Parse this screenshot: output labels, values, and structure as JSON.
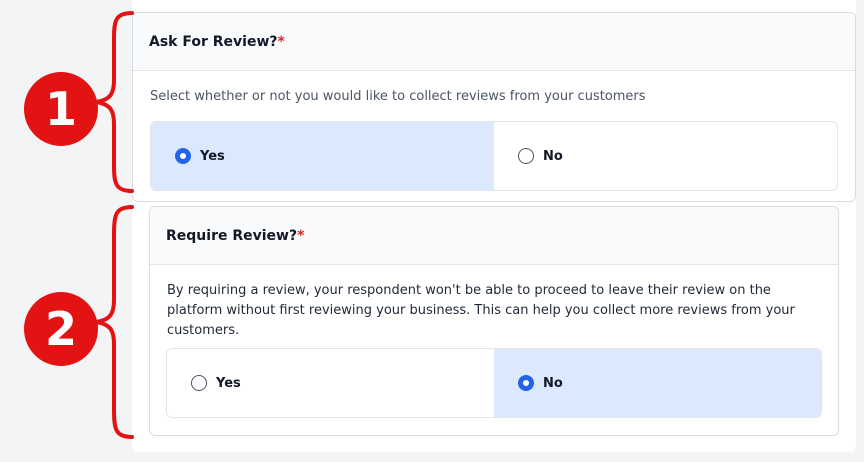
{
  "annotations": [
    {
      "label": "1"
    },
    {
      "label": "2"
    }
  ],
  "ask_review": {
    "title": "Ask For Review?",
    "required_mark": "*",
    "description": "Select whether or not you would like to collect reviews from your customers",
    "options": [
      {
        "label": "Yes",
        "selected": true
      },
      {
        "label": "No",
        "selected": false
      }
    ]
  },
  "require_review": {
    "title": "Require Review?",
    "required_mark": "*",
    "description": "By requiring a review, your respondent won't be able to proceed to leave their review on the platform without first reviewing your business. This can help you collect more reviews from your customers.",
    "options": [
      {
        "label": "Yes",
        "selected": false
      },
      {
        "label": "No",
        "selected": true
      }
    ]
  },
  "colors": {
    "accent": "#2563eb",
    "selected_bg": "#dbe8fd",
    "required": "#e02424",
    "annotation": "#e41313"
  }
}
